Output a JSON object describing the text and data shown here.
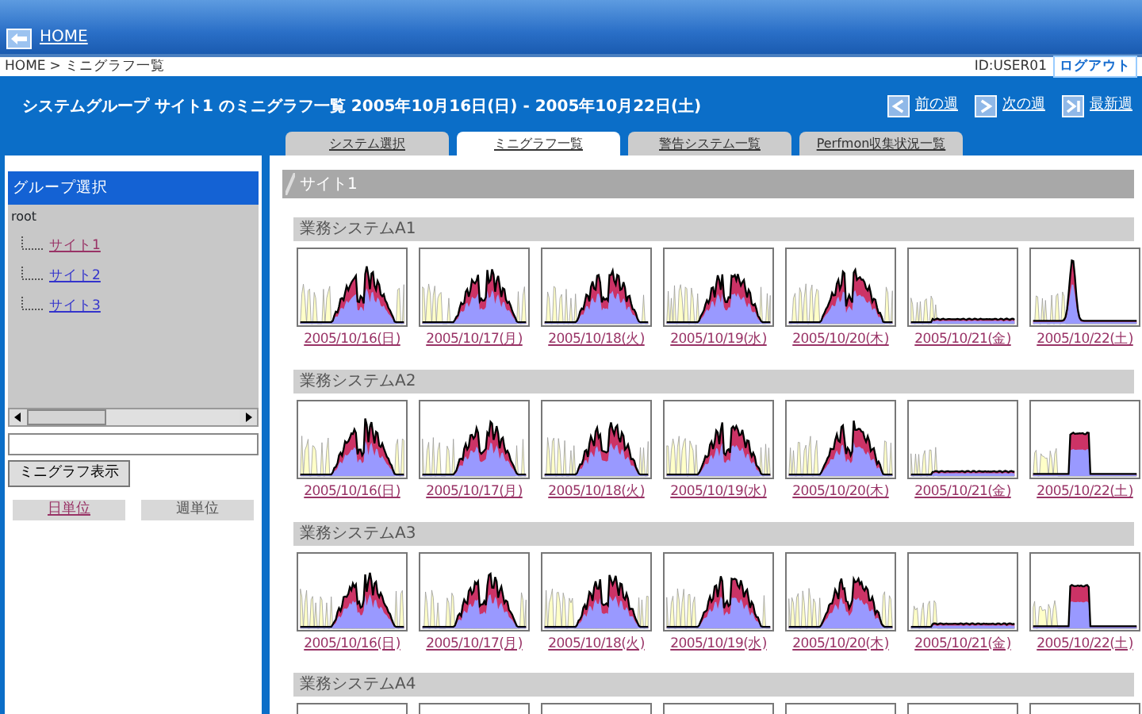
{
  "top_bar": {
    "home_link": "HOME"
  },
  "breadcrumb": {
    "home": "HOME",
    "separator": ">",
    "current": "ミニグラフ一覧",
    "user_id": "ID:USER01",
    "logout": "ログアウト"
  },
  "title_band": {
    "title": "システムグループ サイト1 のミニグラフ一覧 2005年10月16日(日) - 2005年10月22日(土)",
    "nav": [
      {
        "label": "前の週",
        "kind": "prev"
      },
      {
        "label": "次の週",
        "kind": "next"
      },
      {
        "label": "最新週",
        "kind": "latest"
      }
    ]
  },
  "tabs": [
    {
      "label": "システム選択",
      "selected": false
    },
    {
      "label": "ミニグラフ一覧",
      "selected": true
    },
    {
      "label": "警告システム一覧",
      "selected": false
    },
    {
      "label": "Perfmon収集状況一覧",
      "selected": false
    }
  ],
  "sidebar": {
    "title": "グループ選択",
    "tree": {
      "label": "root",
      "children": [
        {
          "label": "サイト1",
          "visited": true
        },
        {
          "label": "サイト2",
          "visited": false
        },
        {
          "label": "サイト3",
          "visited": false
        }
      ]
    },
    "show_button": "ミニグラフ表示",
    "units": [
      {
        "label": "日単位",
        "selected": true
      },
      {
        "label": "週単位",
        "selected": false
      }
    ]
  },
  "content": {
    "heading": "サイト1",
    "sections": [
      {
        "title": "業務システムA1",
        "days": [
          {
            "date": "2005/10/16(日)",
            "kind": "busy"
          },
          {
            "date": "2005/10/17(月)",
            "kind": "busy"
          },
          {
            "date": "2005/10/18(火)",
            "kind": "busy"
          },
          {
            "date": "2005/10/19(水)",
            "kind": "busy"
          },
          {
            "date": "2005/10/20(木)",
            "kind": "busy"
          },
          {
            "date": "2005/10/21(金)",
            "kind": "quiet"
          },
          {
            "date": "2005/10/22(土)",
            "kind": "spike"
          }
        ]
      },
      {
        "title": "業務システムA2",
        "days": [
          {
            "date": "2005/10/16(日)",
            "kind": "busy"
          },
          {
            "date": "2005/10/17(月)",
            "kind": "busy"
          },
          {
            "date": "2005/10/18(火)",
            "kind": "busy"
          },
          {
            "date": "2005/10/19(水)",
            "kind": "busy"
          },
          {
            "date": "2005/10/20(木)",
            "kind": "busy"
          },
          {
            "date": "2005/10/21(金)",
            "kind": "quiet"
          },
          {
            "date": "2005/10/22(土)",
            "kind": "hump"
          }
        ]
      },
      {
        "title": "業務システムA3",
        "days": [
          {
            "date": "2005/10/16(日)",
            "kind": "busy"
          },
          {
            "date": "2005/10/17(月)",
            "kind": "busy"
          },
          {
            "date": "2005/10/18(火)",
            "kind": "busy"
          },
          {
            "date": "2005/10/19(水)",
            "kind": "busy"
          },
          {
            "date": "2005/10/20(木)",
            "kind": "busy"
          },
          {
            "date": "2005/10/21(金)",
            "kind": "quiet"
          },
          {
            "date": "2005/10/22(土)",
            "kind": "hump"
          }
        ]
      },
      {
        "title": "業務システムA4",
        "days": [
          {
            "kind": "blank"
          },
          {
            "kind": "blank"
          },
          {
            "kind": "blank"
          },
          {
            "kind": "blank"
          },
          {
            "kind": "blank"
          },
          {
            "kind": "blank"
          },
          {
            "kind": "blank"
          }
        ]
      }
    ]
  }
}
